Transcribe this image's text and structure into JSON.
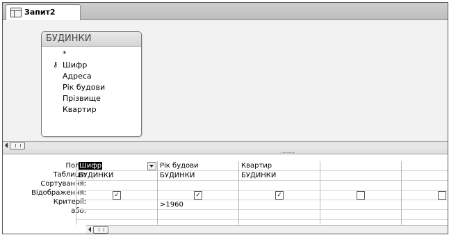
{
  "tab": {
    "title": "Запит2",
    "icon": "query-icon"
  },
  "table_box": {
    "title": "БУДИНКИ",
    "fields": [
      "*",
      "Шифр",
      "Адреса",
      "Рік будови",
      "Прізвище",
      "Квартир"
    ],
    "key_field_index": 1
  },
  "grid": {
    "row_labels": [
      "Поле:",
      "Таблиця:",
      "Сортування:",
      "Відображення:",
      "Критерії:",
      "або:"
    ],
    "columns": [
      {
        "field": "Шифр",
        "table": "БУДИНКИ",
        "sort": "",
        "show": true,
        "criteria": "",
        "or": "",
        "selected": true
      },
      {
        "field": "Рік будови",
        "table": "БУДИНКИ",
        "sort": "",
        "show": true,
        "criteria": ">1960",
        "or": ""
      },
      {
        "field": "Квартир",
        "table": "БУДИНКИ",
        "sort": "",
        "show": true,
        "criteria": "",
        "or": ""
      },
      {
        "field": "",
        "table": "",
        "sort": "",
        "show": false,
        "criteria": "",
        "or": ""
      },
      {
        "field": "",
        "table": "",
        "sort": "",
        "show": false,
        "criteria": "",
        "or": ""
      }
    ]
  },
  "splitter_dots": "........."
}
